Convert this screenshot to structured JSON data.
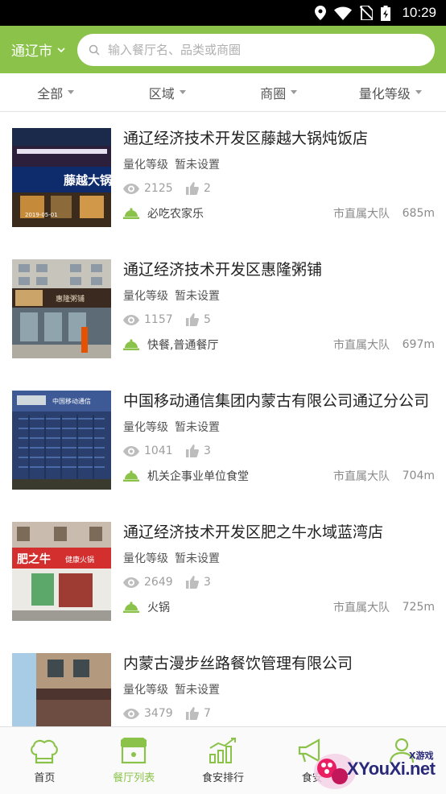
{
  "status_bar": {
    "time": "10:29"
  },
  "header": {
    "city": "通辽市",
    "search_placeholder": "输入餐厅名、品类或商圈"
  },
  "filters": [
    "全部",
    "区域",
    "商圈",
    "量化等级"
  ],
  "restaurants": [
    {
      "name": "通辽经济技术开发区藤越大锅炖饭店",
      "grade_label": "量化等级",
      "grade_value": "暂未设置",
      "views": "2125",
      "likes": "2",
      "category": "必吃农家乐",
      "team": "市直属大队",
      "distance": "685m",
      "photo_text": [
        "藤越大锅",
        "2019-05-01"
      ]
    },
    {
      "name": "通辽经济技术开发区惠隆粥铺",
      "grade_label": "量化等级",
      "grade_value": "暂未设置",
      "views": "1157",
      "likes": "5",
      "category": "快餐,普通餐厅",
      "team": "市直属大队",
      "distance": "697m",
      "photo_text": [
        "惠隆粥铺"
      ]
    },
    {
      "name": "中国移动通信集团内蒙古有限公司通辽分公司",
      "grade_label": "量化等级",
      "grade_value": "暂未设置",
      "views": "1041",
      "likes": "3",
      "category": "机关企事业单位食堂",
      "team": "市直属大队",
      "distance": "704m",
      "photo_text": [
        "中国移动通信"
      ]
    },
    {
      "name": "通辽经济技术开发区肥之牛水域蓝湾店",
      "grade_label": "量化等级",
      "grade_value": "暂未设置",
      "views": "2649",
      "likes": "3",
      "category": "火锅",
      "team": "市直属大队",
      "distance": "725m",
      "photo_text": [
        "肥之牛",
        "健康火锅"
      ]
    },
    {
      "name": "内蒙古漫步丝路餐饮管理有限公司",
      "grade_label": "量化等级",
      "grade_value": "暂未设置",
      "views": "3479",
      "likes": "7",
      "category": "",
      "team": "",
      "distance": "",
      "photo_text": []
    }
  ],
  "tabs": [
    {
      "label": "首页",
      "icon": "chef-hat-icon",
      "active": false
    },
    {
      "label": "餐厅列表",
      "icon": "restaurant-list-icon",
      "active": true
    },
    {
      "label": "食安排行",
      "icon": "ranking-chart-icon",
      "active": false
    },
    {
      "label": "食安",
      "icon": "megaphone-icon",
      "active": false
    },
    {
      "label": "",
      "icon": "profile-icon",
      "active": false
    }
  ],
  "watermark": {
    "text": "XYouXi.net",
    "small": "X游戏"
  },
  "colors": {
    "accent": "#8bc34a",
    "status_bar": "#000000"
  }
}
